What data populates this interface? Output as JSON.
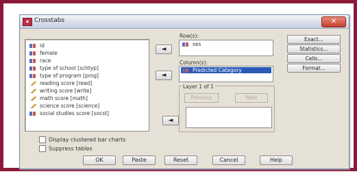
{
  "window": {
    "title": "Crosstabs",
    "app_icon": "spss-icon",
    "close_glyph": "✕"
  },
  "variables": [
    {
      "label": "id",
      "icon": "nominal"
    },
    {
      "label": "female",
      "icon": "nominal"
    },
    {
      "label": "race",
      "icon": "nominal"
    },
    {
      "label": "type of school [schtyp]",
      "icon": "nominal"
    },
    {
      "label": "type of program [prog]",
      "icon": "nominal"
    },
    {
      "label": "reading score [read]",
      "icon": "scale"
    },
    {
      "label": "writing score [write]",
      "icon": "scale"
    },
    {
      "label": "math score [math]",
      "icon": "scale"
    },
    {
      "label": "science score [science]",
      "icon": "scale"
    },
    {
      "label": "social studies score [socst]",
      "icon": "nominal"
    }
  ],
  "rows": {
    "label": "Row(s):",
    "items": [
      "ses"
    ]
  },
  "columns": {
    "label": "Column(s):",
    "items": [
      "Predicted Category"
    ]
  },
  "layer": {
    "label": "Layer 1 of 1",
    "previous": "Previous",
    "next": "Next"
  },
  "arrow_glyph": "◄",
  "side_buttons": [
    "Exact...",
    "Statistics...",
    "Cells...",
    "Format..."
  ],
  "options": [
    {
      "label": "Display clustered bar charts",
      "checked": false
    },
    {
      "label": "Suppress tables",
      "checked": false
    }
  ],
  "bottom_buttons": [
    "OK",
    "Paste",
    "Reset",
    "Cancel",
    "Help"
  ],
  "colors": {
    "frame_border": "#8b1a3a",
    "selection": "#2a5ab8",
    "dialog_bg": "#e6e1d6"
  }
}
